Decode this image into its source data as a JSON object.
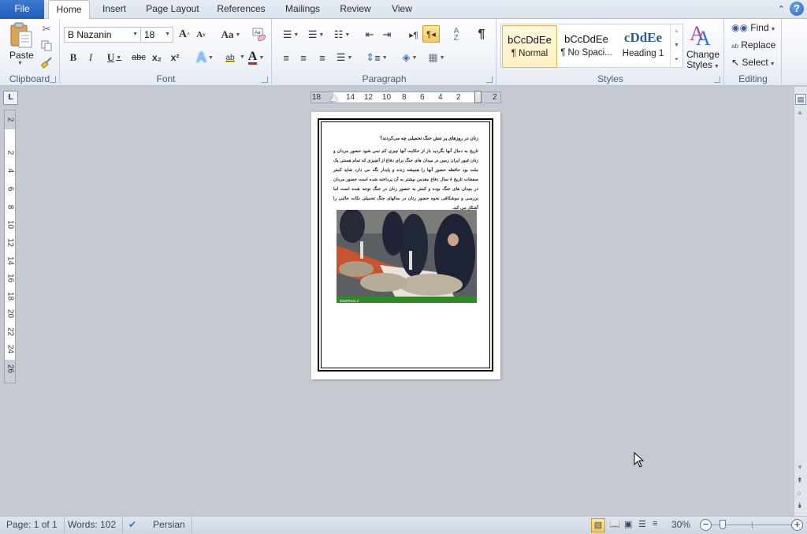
{
  "tabs": {
    "file": "File",
    "home": "Home",
    "insert": "Insert",
    "page_layout": "Page Layout",
    "references": "References",
    "mailings": "Mailings",
    "review": "Review",
    "view": "View"
  },
  "title_controls": {
    "minimize_ribbon_icon": "chevron-up-icon",
    "help": "?"
  },
  "clipboard": {
    "paste_label": "Paste",
    "group_label": "Clipboard"
  },
  "font": {
    "font_name": "B Nazanin",
    "font_size": "18",
    "bold": "B",
    "italic": "I",
    "underline": "U",
    "strikethrough": "abc",
    "subscript": "x₂",
    "superscript": "x²",
    "change_case": "Aa",
    "grow": "A",
    "shrink": "A",
    "highlight": "ab",
    "font_color": "A",
    "group_label": "Font",
    "highlight_color": "#f5f000",
    "font_color_bar": "#d01c1c"
  },
  "paragraph": {
    "group_label": "Paragraph",
    "show_marks": "¶",
    "rtl_active": true
  },
  "styles": {
    "group_label": "Styles",
    "items": [
      {
        "preview": "bCcDdEe",
        "label": "¶ Normal",
        "selected": true
      },
      {
        "preview": "bCcDdEe",
        "label": "¶ No Spaci...",
        "selected": false
      },
      {
        "preview": "cDdEe",
        "label": "Heading 1",
        "selected": false
      }
    ],
    "change_styles_line1": "Change",
    "change_styles_line2": "Styles"
  },
  "editing": {
    "group_label": "Editing",
    "find": "Find",
    "replace": "Replace",
    "select": "Select"
  },
  "ruler": {
    "horizontal_ticks": [
      "18",
      "14",
      "12",
      "10",
      "8",
      "6",
      "4",
      "2",
      "2"
    ],
    "vertical_ticks": [
      "2",
      "2",
      "4",
      "6",
      "8",
      "10",
      "12",
      "14",
      "16",
      "18",
      "20",
      "22",
      "24",
      "26"
    ],
    "tab_selector": "L"
  },
  "document": {
    "title": "زنان در روزهای پر تنش جنگ تحمیلی چه می‌کردند؟",
    "body": "تاریخ به دنبال آنها بگردید باز از حکایت آنها چیزی کم نمی شود حضور مردان و زنان غیور ایران زمین در میدان های جنگ برای دفاع از آنچیزی که تمام هستی یک ملت بود حافظه حضور آنها را همیشه زنده و پایدار نگه می دارد شاید کمتر صفحات تاریخ ۸ سال دفاع مقدس بیشتر به آن پرداخته شده است حضور مردان در میدان های جنگ بوده و کمتر به حضور زنان در جنگ توجه شده است اما بررسی و موشکافی نحوه حضور زنان در سالهای جنگ تحمیلی نکات جالبی را آشکار می کند.",
    "image_caption": "DasiPress.ir",
    "image_alt": "women sewing at workshop"
  },
  "status_bar": {
    "page": "Page: 1 of 1",
    "words": "Words: 102",
    "language": "Persian",
    "zoom": "30%",
    "zoom_percent": 30
  }
}
